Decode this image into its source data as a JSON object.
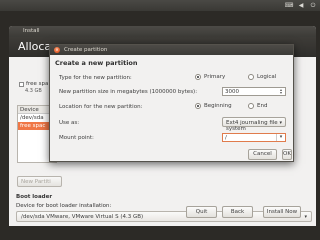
{
  "background_window": {
    "title": "Install",
    "heading": "Alloca",
    "free_space_label": "free spa",
    "free_space_size": "4.3 GB",
    "table_header": "Device",
    "table_rows": [
      "/dev/sda",
      "free spac"
    ],
    "new_partition_button": "New Partiti",
    "boot_loader_heading": "Boot loader",
    "boot_device_label": "Device for boot loader installation:",
    "boot_device_value": "/dev/sda VMware, VMware Virtual S (4.3 GB)",
    "quit_button": "Quit",
    "back_button": "Back",
    "install_button": "Install Now"
  },
  "dialog": {
    "title": "Create partition",
    "heading": "Create a new partition",
    "type_label": "Type for the new partition:",
    "type_options": [
      "Primary",
      "Logical"
    ],
    "type_selected": "Primary",
    "size_label": "New partition size in megabytes (1000000 bytes):",
    "size_value": "3000",
    "location_label": "Location for the new partition:",
    "location_options": [
      "Beginning",
      "End"
    ],
    "location_selected": "Beginning",
    "use_as_label": "Use as:",
    "use_as_value": "Ext4 journaling file system",
    "mount_label": "Mount point:",
    "mount_value": "/",
    "cancel_button": "Cancel",
    "ok_button": "OK"
  },
  "colors": {
    "accent": "#f07746",
    "titlebar": "#3c3b37"
  }
}
